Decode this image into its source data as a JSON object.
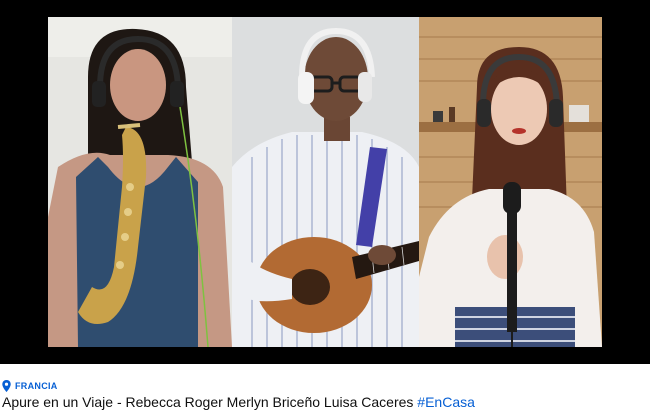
{
  "video": {
    "panels": [
      {
        "id": "saxophonist",
        "background": "#e4e4e0",
        "instrument": "saxophone"
      },
      {
        "id": "guitarist",
        "background": "#d2d4d6",
        "instrument": "cuatro"
      },
      {
        "id": "singer",
        "background": "#c79a66",
        "instrument": "microphone"
      }
    ]
  },
  "info": {
    "location_icon": "location-pin-icon",
    "location": "FRANCIA",
    "title": "Apure en un Viaje - Rebecca Roger Merlyn Briceño Luisa Caceres",
    "hashtag": "#EnCasa",
    "accent_color": "#065fd4"
  }
}
